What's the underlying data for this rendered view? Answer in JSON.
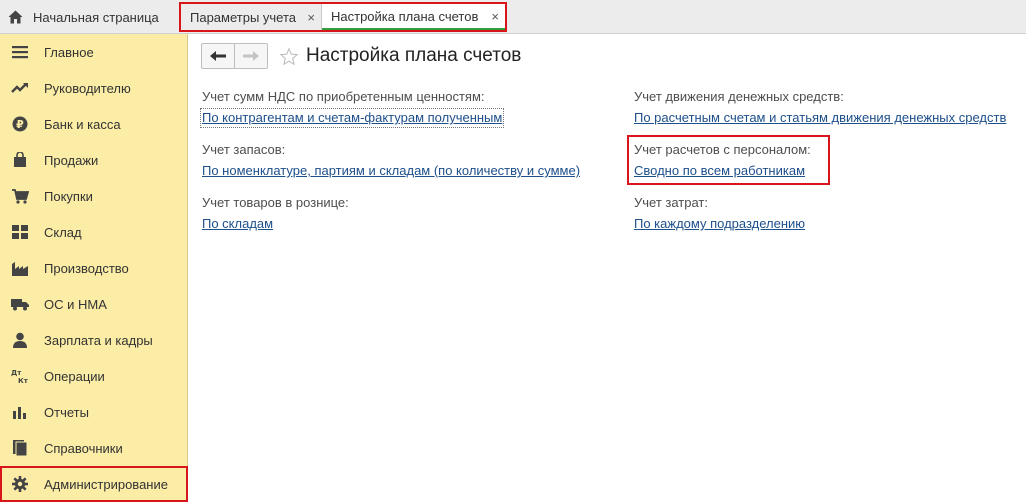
{
  "topbar": {
    "home_label": "Начальная страница",
    "tabs": [
      {
        "label": "Параметры учета",
        "close": "×"
      },
      {
        "label": "Настройка плана счетов",
        "close": "×"
      }
    ]
  },
  "sidebar": {
    "items": [
      {
        "label": "Главное",
        "icon": "menu-icon"
      },
      {
        "label": "Руководителю",
        "icon": "trend-icon"
      },
      {
        "label": "Банк и касса",
        "icon": "ruble-icon"
      },
      {
        "label": "Продажи",
        "icon": "bag-icon"
      },
      {
        "label": "Покупки",
        "icon": "cart-icon"
      },
      {
        "label": "Склад",
        "icon": "grid-icon"
      },
      {
        "label": "Производство",
        "icon": "factory-icon"
      },
      {
        "label": "ОС и НМА",
        "icon": "truck-icon"
      },
      {
        "label": "Зарплата и кадры",
        "icon": "person-icon"
      },
      {
        "label": "Операции",
        "icon": "dt-kt-icon",
        "icon_text": "Дт Кт"
      },
      {
        "label": "Отчеты",
        "icon": "bar-chart-icon"
      },
      {
        "label": "Справочники",
        "icon": "book-icon"
      },
      {
        "label": "Администрирование",
        "icon": "gear-icon",
        "active": true
      }
    ]
  },
  "page": {
    "title": "Настройка плана счетов"
  },
  "settings": {
    "vat": {
      "label": "Учет сумм НДС по приобретенным ценностям:",
      "value": "По контрагентам и счетам-фактурам полученным"
    },
    "stock": {
      "label": "Учет запасов:",
      "value": "По номенклатуре, партиям и складам (по количеству и сумме)"
    },
    "retail": {
      "label": "Учет товаров в рознице:",
      "value": "По складам"
    },
    "cash_flow": {
      "label": "Учет движения денежных средств:",
      "value": "По расчетным счетам и статьям движения денежных средств"
    },
    "personnel": {
      "label": "Учет расчетов с персоналом:",
      "value": "Сводно по всем работникам"
    },
    "costs": {
      "label": "Учет затрат:",
      "value": "По каждому подразделению"
    }
  },
  "colors": {
    "sidebar_bg": "#fbeca6",
    "highlight_red": "#d9151c",
    "link_blue": "#1d4f8b",
    "active_tab_underline": "#2f9f3f"
  }
}
